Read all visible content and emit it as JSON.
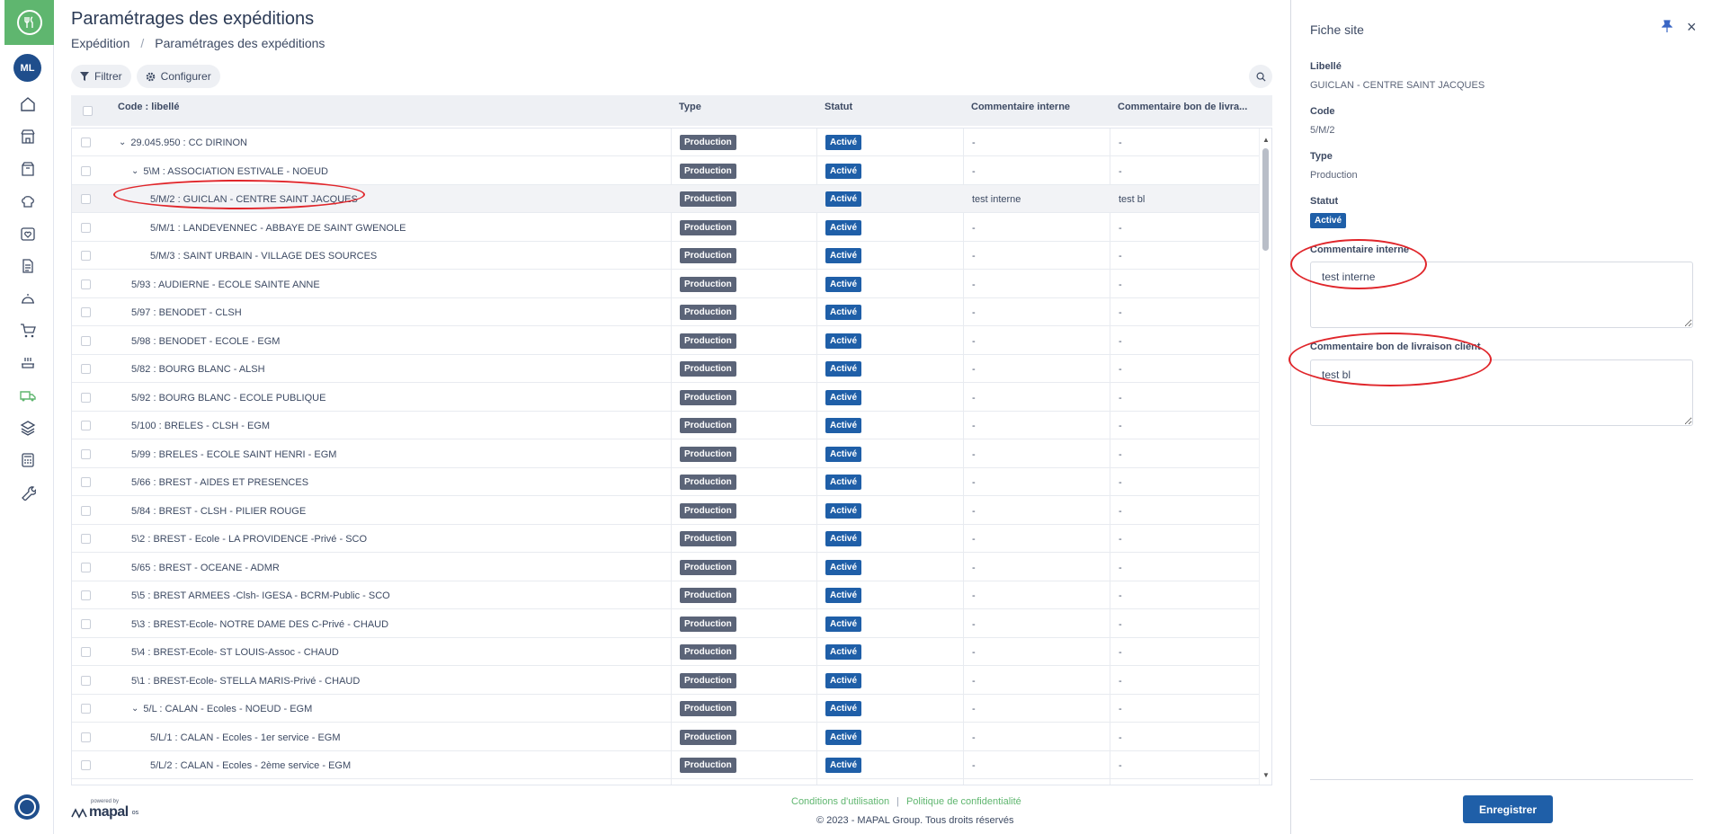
{
  "nav": {
    "avatar": "ML",
    "icons": [
      "home-icon",
      "store-icon",
      "box-icon",
      "chef-hat-icon",
      "heart-list-icon",
      "document-icon",
      "cloche-icon",
      "cart-icon",
      "cooking-icon",
      "truck-icon",
      "layers-icon",
      "calculator-icon",
      "wrench-icon"
    ]
  },
  "header": {
    "title": "Paramétrages des expéditions",
    "breadcrumb": [
      "Expédition",
      "Paramétrages des expéditions"
    ]
  },
  "toolbar": {
    "filter_label": "Filtrer",
    "configure_label": "Configurer"
  },
  "table": {
    "columns": [
      "Code : libellé",
      "Type",
      "Statut",
      "Commentaire interne",
      "Commentaire bon de livra..."
    ],
    "rows": [
      {
        "label": "29.045.950 : CC DIRINON",
        "level": 0,
        "expand": true,
        "type": "Production",
        "status": "Activé",
        "ci": "-",
        "cb": "-"
      },
      {
        "label": "5\\M : ASSOCIATION ESTIVALE - NOEUD",
        "level": 1,
        "expand": true,
        "type": "Production",
        "status": "Activé",
        "ci": "-",
        "cb": "-"
      },
      {
        "label": "5/M/2 : GUICLAN - CENTRE SAINT JACQUES",
        "level": 2,
        "expand": false,
        "type": "Production",
        "status": "Activé",
        "ci": "test interne",
        "cb": "test bl",
        "selected": true
      },
      {
        "label": "5/M/1 : LANDEVENNEC - ABBAYE DE SAINT GWENOLE",
        "level": 2,
        "expand": false,
        "type": "Production",
        "status": "Activé",
        "ci": "-",
        "cb": "-"
      },
      {
        "label": "5/M/3 : SAINT URBAIN - VILLAGE DES SOURCES",
        "level": 2,
        "expand": false,
        "type": "Production",
        "status": "Activé",
        "ci": "-",
        "cb": "-"
      },
      {
        "label": "5/93 : AUDIERNE - ECOLE SAINTE ANNE",
        "level": 1,
        "expand": false,
        "type": "Production",
        "status": "Activé",
        "ci": "-",
        "cb": "-"
      },
      {
        "label": "5/97 : BENODET - CLSH",
        "level": 1,
        "expand": false,
        "type": "Production",
        "status": "Activé",
        "ci": "-",
        "cb": "-"
      },
      {
        "label": "5/98 : BENODET - ECOLE - EGM",
        "level": 1,
        "expand": false,
        "type": "Production",
        "status": "Activé",
        "ci": "-",
        "cb": "-"
      },
      {
        "label": "5/82 : BOURG BLANC - ALSH",
        "level": 1,
        "expand": false,
        "type": "Production",
        "status": "Activé",
        "ci": "-",
        "cb": "-"
      },
      {
        "label": "5/92 : BOURG BLANC - ECOLE PUBLIQUE",
        "level": 1,
        "expand": false,
        "type": "Production",
        "status": "Activé",
        "ci": "-",
        "cb": "-"
      },
      {
        "label": "5/100 : BRELES - CLSH - EGM",
        "level": 1,
        "expand": false,
        "type": "Production",
        "status": "Activé",
        "ci": "-",
        "cb": "-"
      },
      {
        "label": "5/99 : BRELES - ECOLE SAINT HENRI - EGM",
        "level": 1,
        "expand": false,
        "type": "Production",
        "status": "Activé",
        "ci": "-",
        "cb": "-"
      },
      {
        "label": "5/66 : BREST - AIDES ET PRESENCES",
        "level": 1,
        "expand": false,
        "type": "Production",
        "status": "Activé",
        "ci": "-",
        "cb": "-"
      },
      {
        "label": "5/84 : BREST - CLSH - PILIER ROUGE",
        "level": 1,
        "expand": false,
        "type": "Production",
        "status": "Activé",
        "ci": "-",
        "cb": "-"
      },
      {
        "label": "5\\2 : BREST - Ecole - LA PROVIDENCE -Privé - SCO",
        "level": 1,
        "expand": false,
        "type": "Production",
        "status": "Activé",
        "ci": "-",
        "cb": "-"
      },
      {
        "label": "5/65 : BREST - OCEANE - ADMR",
        "level": 1,
        "expand": false,
        "type": "Production",
        "status": "Activé",
        "ci": "-",
        "cb": "-"
      },
      {
        "label": "5\\5 : BREST ARMEES -Clsh- IGESA - BCRM-Public - SCO",
        "level": 1,
        "expand": false,
        "type": "Production",
        "status": "Activé",
        "ci": "-",
        "cb": "-"
      },
      {
        "label": "5\\3 : BREST-Ecole- NOTRE DAME DES C-Privé - CHAUD",
        "level": 1,
        "expand": false,
        "type": "Production",
        "status": "Activé",
        "ci": "-",
        "cb": "-"
      },
      {
        "label": "5\\4 : BREST-Ecole- ST LOUIS-Assoc - CHAUD",
        "level": 1,
        "expand": false,
        "type": "Production",
        "status": "Activé",
        "ci": "-",
        "cb": "-"
      },
      {
        "label": "5\\1 : BREST-Ecole- STELLA MARIS-Privé - CHAUD",
        "level": 1,
        "expand": false,
        "type": "Production",
        "status": "Activé",
        "ci": "-",
        "cb": "-"
      },
      {
        "label": "5/L : CALAN - Ecoles - NOEUD - EGM",
        "level": 1,
        "expand": true,
        "type": "Production",
        "status": "Activé",
        "ci": "-",
        "cb": "-"
      },
      {
        "label": "5/L/1 : CALAN - Ecoles - 1er service - EGM",
        "level": 2,
        "expand": false,
        "type": "Production",
        "status": "Activé",
        "ci": "-",
        "cb": "-"
      },
      {
        "label": "5/L/2 : CALAN - Ecoles - 2ème service - EGM",
        "level": 2,
        "expand": false,
        "type": "Production",
        "status": "Activé",
        "ci": "-",
        "cb": "-"
      }
    ]
  },
  "footer": {
    "powered_by": "powered by",
    "brand": "mapal",
    "brand_suffix": "os",
    "terms": "Conditions d'utilisation",
    "separator": "|",
    "privacy": "Politique de confidentialité",
    "copyright": "© 2023 - MAPAL Group. Tous droits réservés"
  },
  "panel": {
    "title": "Fiche site",
    "libelle_label": "Libellé",
    "libelle_value": "GUICLAN - CENTRE SAINT JACQUES",
    "code_label": "Code",
    "code_value": "5/M/2",
    "type_label": "Type",
    "type_value": "Production",
    "statut_label": "Statut",
    "statut_value": "Activé",
    "ci_label": "Commentaire interne",
    "ci_value": "test interne",
    "cbl_label": "Commentaire bon de livraison client",
    "cbl_value": "test bl",
    "save_label": "Enregistrer"
  },
  "colors": {
    "brand_green": "#5fb66f",
    "primary_blue": "#1f5fa8",
    "type_badge": "#5b6478",
    "annotation_red": "#e0262b"
  }
}
